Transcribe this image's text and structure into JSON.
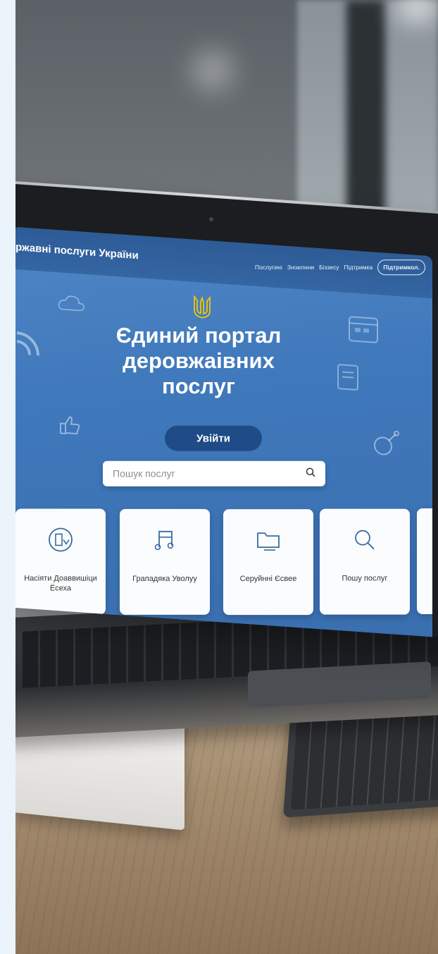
{
  "site": {
    "brand": "ржавні послуги України",
    "nav": [
      {
        "label": "Послугині"
      },
      {
        "label": "Зноилнни"
      },
      {
        "label": "Біззесу"
      },
      {
        "label": "Підтримка"
      }
    ],
    "nav_cta": "Підтримкол.",
    "hero_title": "Єдиний портал деровжаівних послуг",
    "login_label": "Увійти",
    "search_placeholder": "Пошук послуг",
    "cards": [
      {
        "label": "Насіяти Доаввишіци Ёсеха",
        "icon": "refresh-document-icon"
      },
      {
        "label": "Грападяка Уволуу",
        "icon": "music-note-icon"
      },
      {
        "label": "Серуйнні Єсвее",
        "icon": "folder-icon"
      },
      {
        "label": "Пошу послуг",
        "icon": "search-icon"
      }
    ]
  },
  "colors": {
    "hero_blue": "#3f78bb",
    "header_blue": "#2d5b96",
    "button_blue": "#1f4c86",
    "trident_gold": "#f2c500"
  }
}
